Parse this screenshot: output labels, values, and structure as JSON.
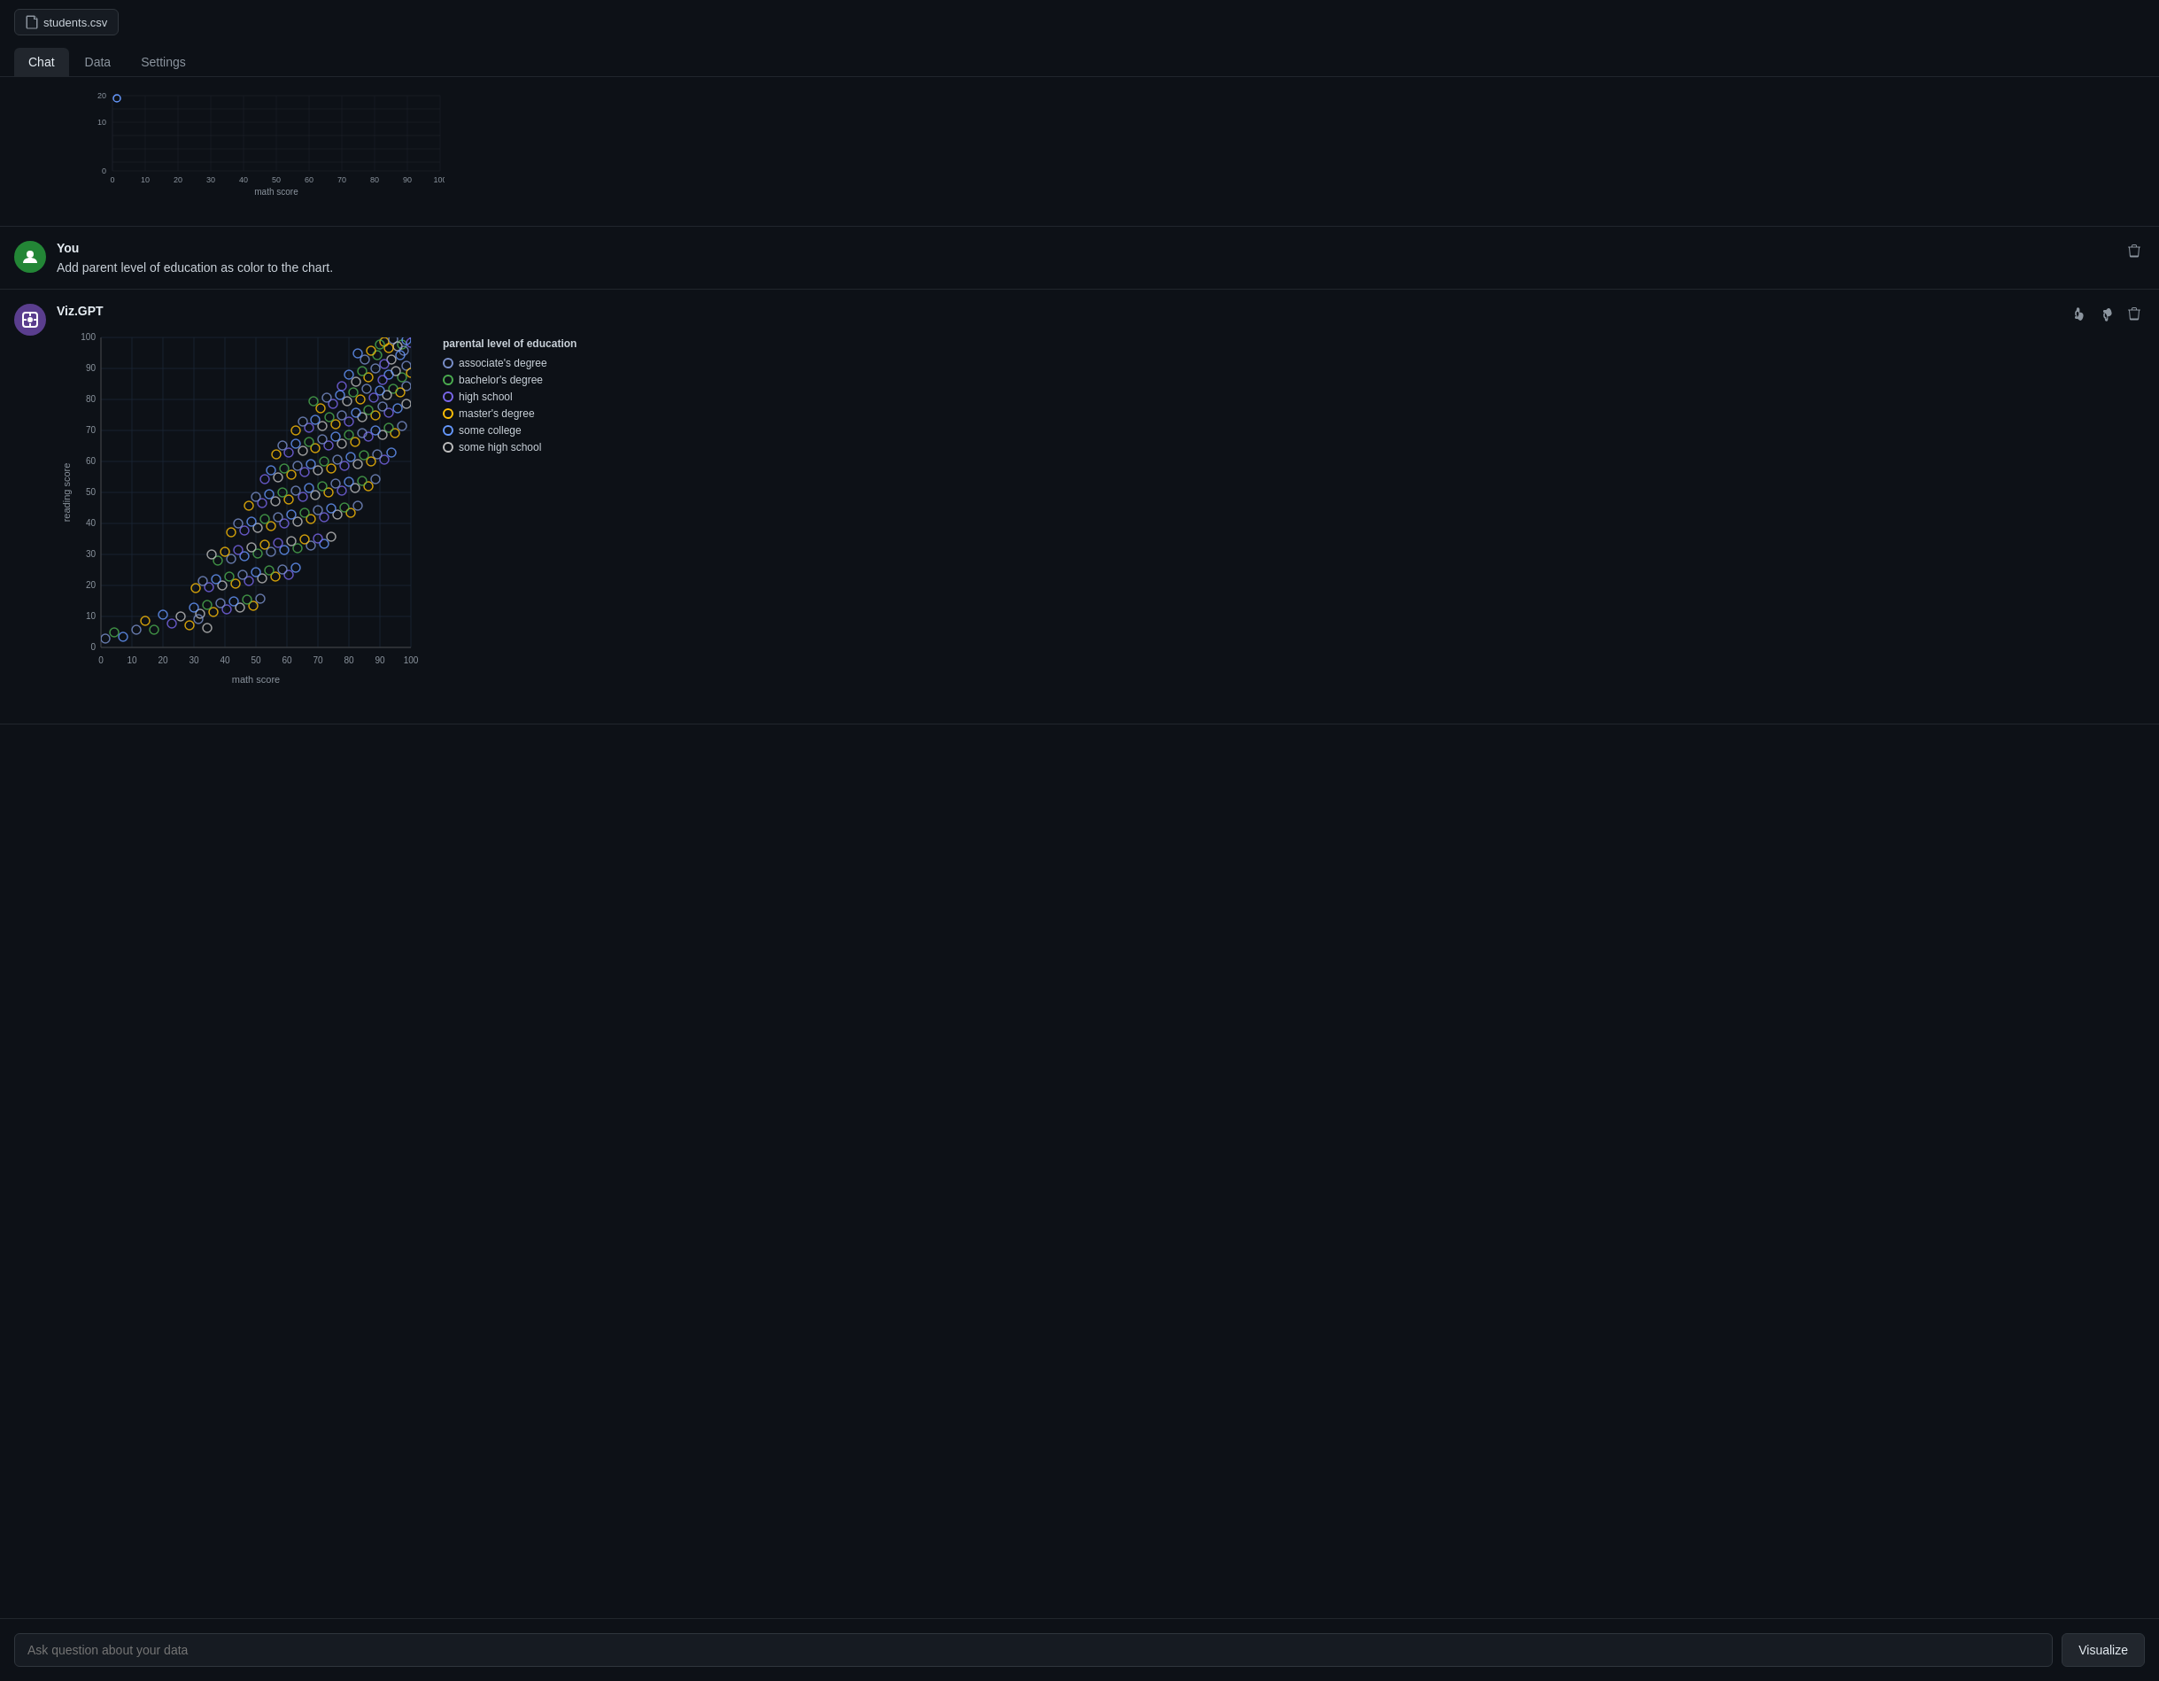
{
  "topbar": {
    "file_label": "students.csv"
  },
  "tabs": [
    {
      "label": "Chat",
      "active": true
    },
    {
      "label": "Data",
      "active": false
    },
    {
      "label": "Settings",
      "active": false
    }
  ],
  "messages": [
    {
      "id": "partial-chart",
      "type": "partial"
    },
    {
      "id": "user-msg",
      "type": "user",
      "author": "You",
      "text": "Add parent level of education as color to the chart."
    },
    {
      "id": "vizgpt-msg",
      "type": "vizgpt",
      "author": "Viz.GPT",
      "chart": {
        "x_label": "math score",
        "y_label": "reading score",
        "x_ticks": [
          0,
          10,
          20,
          30,
          40,
          50,
          60,
          70,
          80,
          90,
          100
        ],
        "y_ticks": [
          0,
          10,
          20,
          30,
          40,
          50,
          60,
          70,
          80,
          90,
          100
        ],
        "legend_title": "parental level of education",
        "legend_items": [
          {
            "label": "associate's degree",
            "color": "#7b91cc"
          },
          {
            "label": "bachelor's degree",
            "color": "#4caf50"
          },
          {
            "label": "high school",
            "color": "#7b68ee"
          },
          {
            "label": "master's degree",
            "color": "#ffc107"
          },
          {
            "label": "some college",
            "color": "#6699ff"
          },
          {
            "label": "some high school",
            "color": "#c0c0c0"
          }
        ]
      }
    }
  ],
  "input": {
    "placeholder": "Ask question about your data",
    "value": ""
  },
  "buttons": {
    "visualize_label": "Visualize",
    "thumbup_label": "👍",
    "thumbdown_label": "👎",
    "delete_label": "🗑"
  }
}
